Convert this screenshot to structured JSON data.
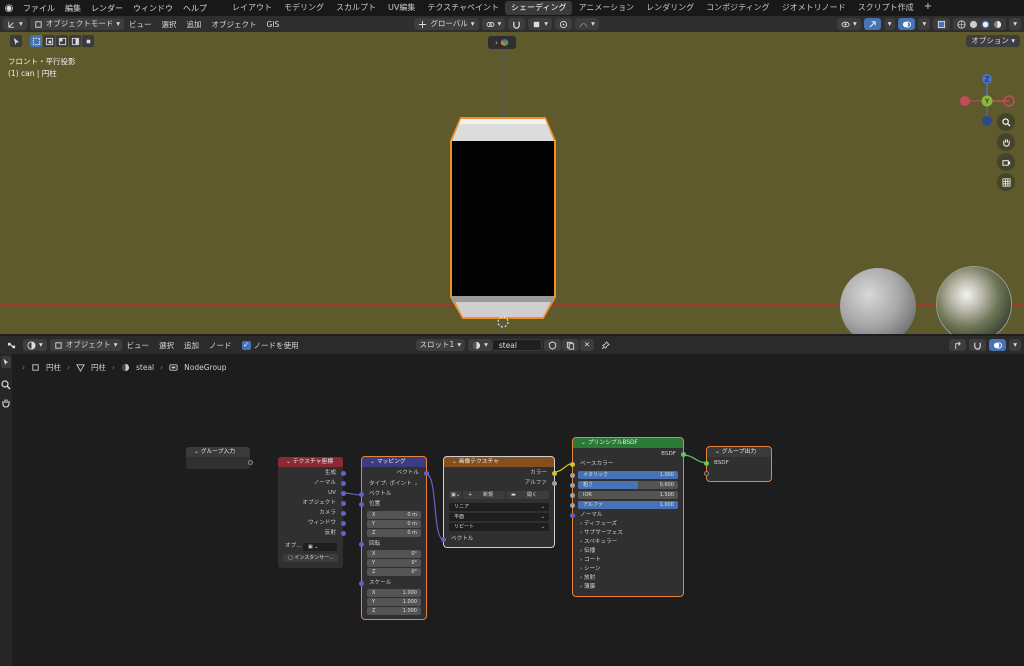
{
  "topbar": {
    "menus": [
      "ファイル",
      "編集",
      "レンダー",
      "ウィンドウ",
      "ヘルプ"
    ],
    "workspaces": [
      "レイアウト",
      "モデリング",
      "スカルプト",
      "UV編集",
      "テクスチャペイント",
      "シェーディング",
      "アニメーション",
      "レンダリング",
      "コンポジティング",
      "ジオメトリノード",
      "スクリプト作成"
    ],
    "active_workspace": "シェーディング"
  },
  "viewport": {
    "mode": "オブジェクトモード",
    "menus": [
      "ビュー",
      "選択",
      "追加",
      "オブジェクト",
      "GIS"
    ],
    "transform_orientation": "グローバル",
    "options_label": "オプション",
    "view_name": "フロント・平行投影",
    "object_info": "(1) can | 円柱",
    "gizmo_labels": {
      "z": "Z",
      "y": "Y"
    }
  },
  "node_editor": {
    "type": "オブジェクト",
    "menus": [
      "ビュー",
      "選択",
      "追加",
      "ノード"
    ],
    "use_nodes_label": "ノードを使用",
    "slot": "スロット1",
    "material": "steal",
    "breadcrumb": [
      "円柱",
      "円柱",
      "steal",
      "NodeGroup"
    ]
  },
  "nodes": {
    "group_input": {
      "title": "グループ入力"
    },
    "texcoord": {
      "title": "テクスチャ座標",
      "outputs": [
        "生成",
        "ノーマル",
        "UV",
        "オブジェクト",
        "カメラ",
        "ウィンドウ",
        "反射"
      ],
      "object_label": "オブ...",
      "instancer_label": "インスタンサー..."
    },
    "mapping": {
      "title": "マッピング",
      "output": "ベクトル",
      "type_label": "タイプ:",
      "type_value": "ポイント",
      "vector_label": "ベクトル",
      "location_label": "位置",
      "location": [
        {
          "axis": "X",
          "value": "0 m"
        },
        {
          "axis": "Y",
          "value": "0 m"
        },
        {
          "axis": "Z",
          "value": "0 m"
        }
      ],
      "rotation_label": "回転",
      "rotation": [
        {
          "axis": "X",
          "value": "0°"
        },
        {
          "axis": "Y",
          "value": "0°"
        },
        {
          "axis": "Z",
          "value": "0°"
        }
      ],
      "scale_label": "スケール",
      "scale": [
        {
          "axis": "X",
          "value": "1.000"
        },
        {
          "axis": "Y",
          "value": "1.000"
        },
        {
          "axis": "Z",
          "value": "1.000"
        }
      ]
    },
    "image_texture": {
      "title": "画像テクスチャ",
      "outputs": [
        "カラー",
        "アルファ"
      ],
      "new_label": "新規",
      "open_label": "開く",
      "interpolation": "リニア",
      "projection": "平面",
      "extension": "リピート",
      "vector_label": "ベクトル"
    },
    "principled": {
      "title": "プリンシプルBSDF",
      "output": "BSDF",
      "base_color_label": "ベースカラー",
      "fields": [
        {
          "label": "メタリック",
          "value": "1.000",
          "fill": 1.0
        },
        {
          "label": "粗さ",
          "value": "0.600",
          "fill": 0.6
        },
        {
          "label": "IOR",
          "value": "1.500",
          "fill": 0.0
        },
        {
          "label": "アルファ",
          "value": "1.000",
          "fill": 1.0
        }
      ],
      "normal_label": "ノーマル",
      "panels": [
        "ディフューズ",
        "サブサーフェス",
        "スペキュラー",
        "伝播",
        "コート",
        "シーン",
        "放射",
        "薄膜"
      ]
    },
    "group_output": {
      "title": "グループ出力",
      "input": "BSDF"
    }
  },
  "colors": {
    "viewport_bg": "#5e5a2c",
    "texcoord_header": "#8a2a35",
    "mapping_header": "#3c3c83",
    "image_header": "#83501e",
    "principled_header": "#2a7a36",
    "group_header": "#3a3a3a",
    "socket_vector": "#6363c7",
    "socket_color": "#c7c729",
    "socket_shader": "#63c763",
    "socket_float": "#a1a1a1",
    "accent_blue": "#4772b3"
  }
}
